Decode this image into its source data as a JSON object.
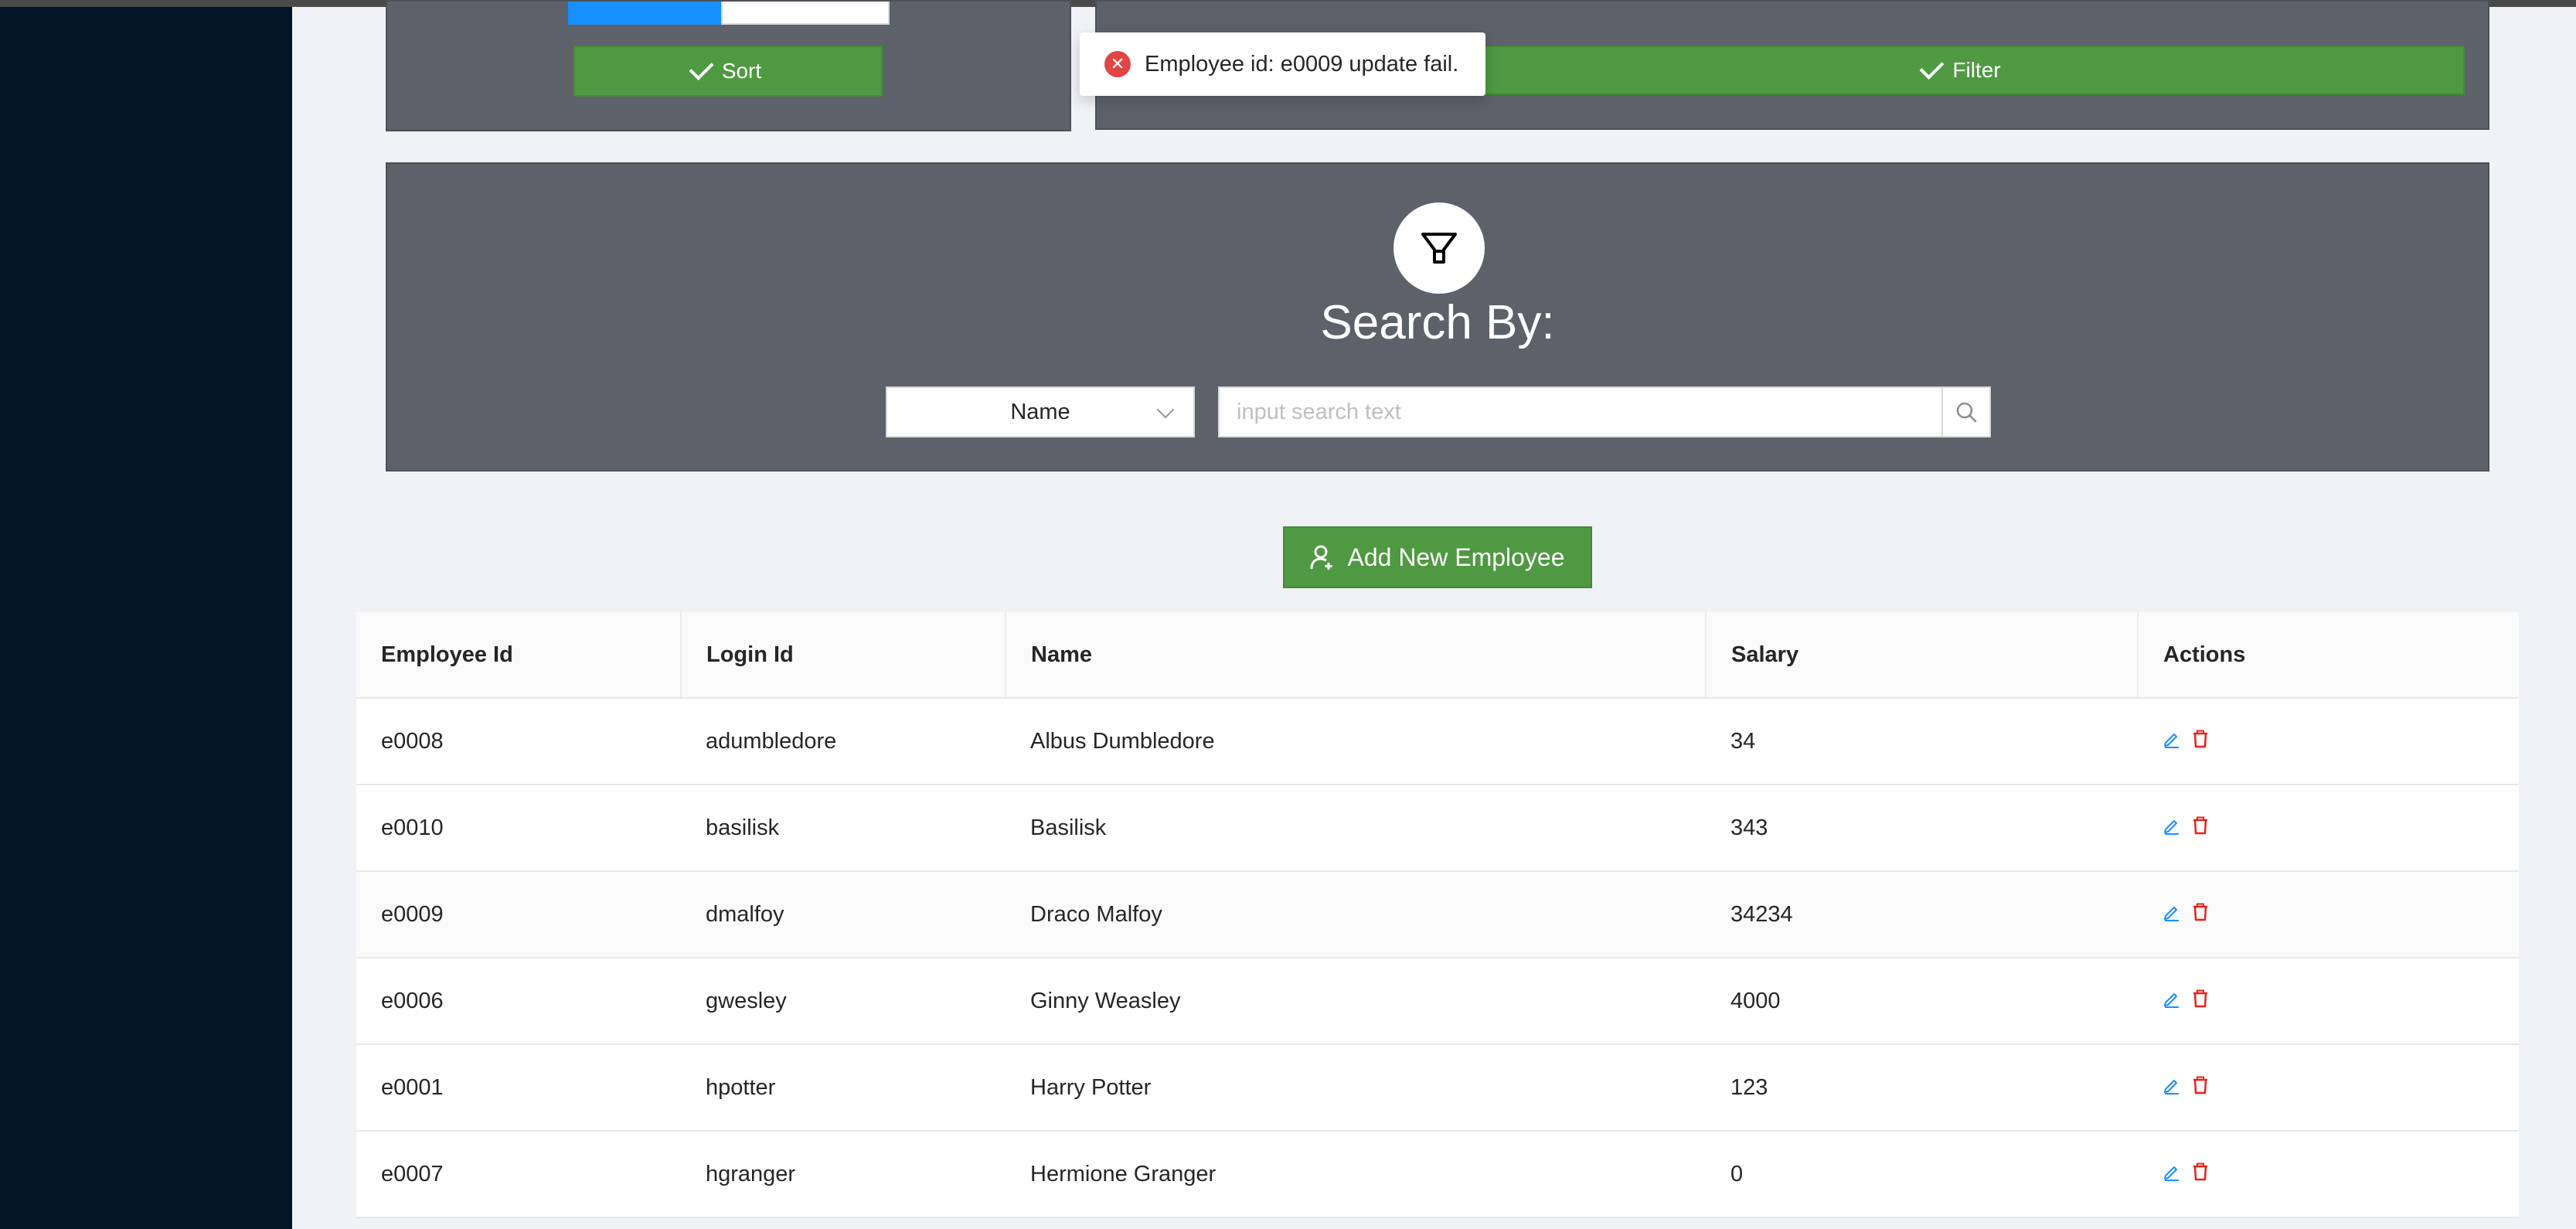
{
  "sort_panel": {
    "sort_label": "Sort"
  },
  "filter_panel": {
    "filter_label": "Filter"
  },
  "notification": {
    "message": "Employee id: e0009 update fail."
  },
  "search": {
    "title": "Search By:",
    "field_selected": "Name",
    "placeholder": "input search text"
  },
  "add_button": {
    "label": "Add New Employee"
  },
  "table": {
    "headers": {
      "employee_id": "Employee Id",
      "login_id": "Login Id",
      "name": "Name",
      "salary": "Salary",
      "actions": "Actions"
    },
    "rows": [
      {
        "employee_id": "e0008",
        "login_id": "adumbledore",
        "name": "Albus Dumbledore",
        "salary": "34"
      },
      {
        "employee_id": "e0010",
        "login_id": "basilisk",
        "name": "Basilisk",
        "salary": "343"
      },
      {
        "employee_id": "e0009",
        "login_id": "dmalfoy",
        "name": "Draco Malfoy",
        "salary": "34234"
      },
      {
        "employee_id": "e0006",
        "login_id": "gwesley",
        "name": "Ginny Weasley",
        "salary": "4000"
      },
      {
        "employee_id": "e0001",
        "login_id": "hpotter",
        "name": "Harry Potter",
        "salary": "123"
      },
      {
        "employee_id": "e0007",
        "login_id": "hgranger",
        "name": "Hermione Granger",
        "salary": "0"
      }
    ]
  },
  "icons": {
    "edit": "edit-icon",
    "delete": "delete-icon",
    "filter": "funnel-icon",
    "search": "search-icon",
    "user_add": "user-add-icon",
    "error": "close-circle-icon",
    "check": "check-icon"
  },
  "colors": {
    "sidebar": "#011428",
    "panel": "#5d6169",
    "green": "#4f9942",
    "edit": "#1890ff",
    "delete": "#e8221b",
    "error": "#e04646"
  }
}
